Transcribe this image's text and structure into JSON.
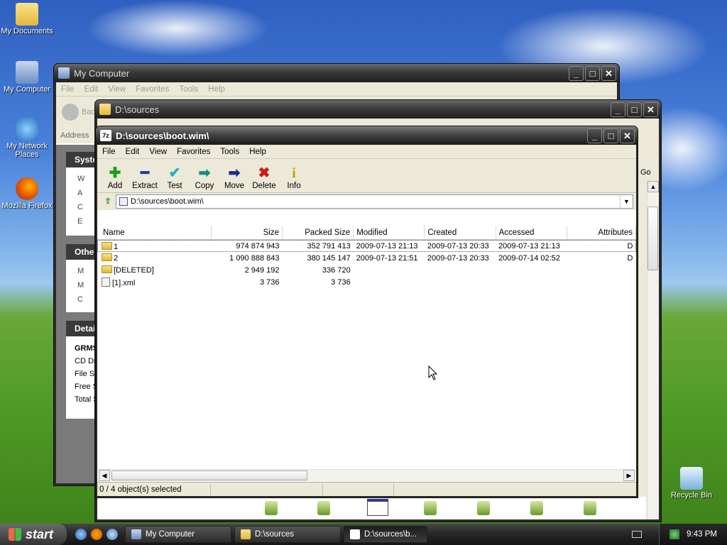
{
  "desktop": {
    "icons": [
      {
        "label": "My Documents"
      },
      {
        "label": "My Computer"
      },
      {
        "label": "My Network Places"
      },
      {
        "label": "Mozilla Firefox"
      },
      {
        "label": "Recycle Bin"
      }
    ]
  },
  "mycomputer": {
    "title": "My Computer",
    "menu": [
      "File",
      "Edit",
      "View",
      "Favorites",
      "Tools",
      "Help"
    ],
    "back_label": "Bac",
    "address_label": "Address",
    "panels": [
      "Syste",
      "Other",
      "Detai"
    ],
    "system_items": [
      "W",
      "A",
      "C",
      "E"
    ],
    "other_items": [
      "M",
      "M",
      "C"
    ],
    "details": {
      "title": "GRMS",
      "lines": [
        "CD Dr",
        "File Sy",
        "Free S",
        "Total S"
      ]
    }
  },
  "sources": {
    "title": "D:\\sources",
    "go_label": "Go"
  },
  "sevenzip": {
    "title": "D:\\sources\\boot.wim\\",
    "title_icon": "7z",
    "menu": [
      "File",
      "Edit",
      "View",
      "Favorites",
      "Tools",
      "Help"
    ],
    "toolbar": [
      {
        "label": "Add",
        "icon": "add-icon",
        "glyph": "✚",
        "color": "#18a018"
      },
      {
        "label": "Extract",
        "icon": "extract-icon",
        "glyph": "━",
        "color": "#1a3fb0"
      },
      {
        "label": "Test",
        "icon": "test-icon",
        "glyph": "✔",
        "color": "#1cb0c8"
      },
      {
        "label": "Copy",
        "icon": "copy-icon",
        "glyph": "➡",
        "color": "#1a8a8a"
      },
      {
        "label": "Move",
        "icon": "move-icon",
        "glyph": "➡",
        "color": "#1a2a9a"
      },
      {
        "label": "Delete",
        "icon": "delete-icon",
        "glyph": "✖",
        "color": "#d01818"
      },
      {
        "label": "Info",
        "icon": "info-icon",
        "glyph": "i",
        "color": "#c8a000"
      }
    ],
    "address": "D:\\sources\\boot.wim\\",
    "columns": [
      "Name",
      "Size",
      "Packed Size",
      "Modified",
      "Created",
      "Accessed",
      "Attributes"
    ],
    "rows": [
      {
        "type": "folder",
        "name": "1",
        "size": "974 874 943",
        "packed": "352 791 413",
        "modified": "2009-07-13 21:13",
        "created": "2009-07-13 20:33",
        "accessed": "2009-07-13 21:13",
        "attr": "D"
      },
      {
        "type": "folder",
        "name": "2",
        "size": "1 090 888 843",
        "packed": "380 145 147",
        "modified": "2009-07-13 21:51",
        "created": "2009-07-13 20:33",
        "accessed": "2009-07-14 02:52",
        "attr": "D"
      },
      {
        "type": "folder",
        "name": "[DELETED]",
        "size": "2 949 192",
        "packed": "336 720",
        "modified": "",
        "created": "",
        "accessed": "",
        "attr": ""
      },
      {
        "type": "file",
        "name": "[1].xml",
        "size": "3 736",
        "packed": "3 736",
        "modified": "",
        "created": "",
        "accessed": "",
        "attr": ""
      }
    ],
    "status": "0 / 4 object(s) selected"
  },
  "taskbar": {
    "start_label": "start",
    "tasks": [
      {
        "label": "My Computer",
        "active": false
      },
      {
        "label": "D:\\sources",
        "active": false
      },
      {
        "label": "D:\\sources\\b...",
        "active": true
      }
    ],
    "clock": "9:43 PM"
  }
}
